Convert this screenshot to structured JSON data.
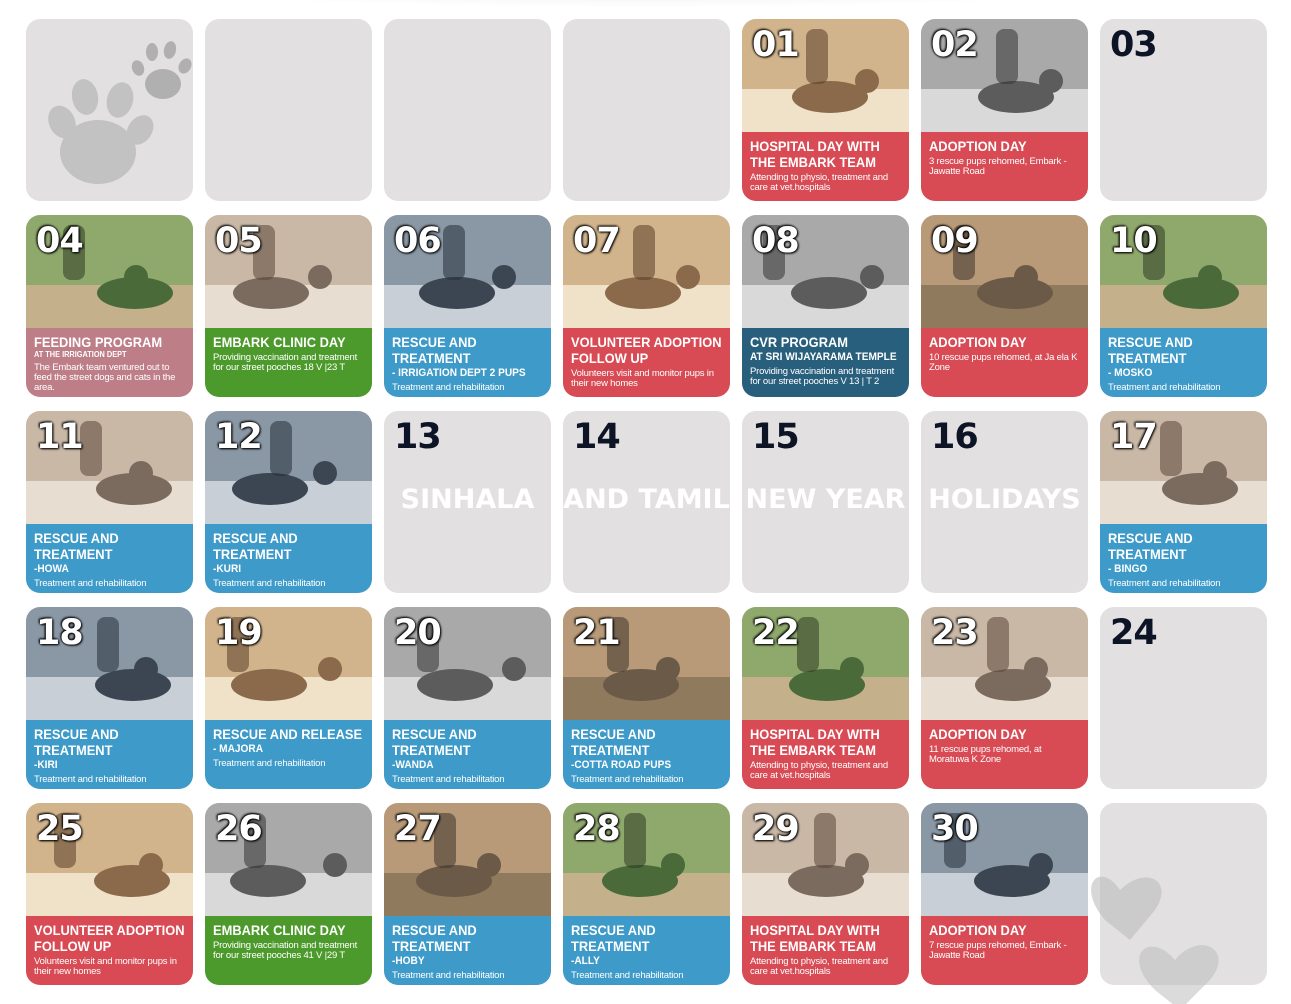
{
  "calendar": {
    "row1": [
      {
        "day": "",
        "type": "empty"
      },
      {
        "day": "",
        "type": "empty"
      },
      {
        "day": "",
        "type": "empty"
      },
      {
        "day": "",
        "type": "empty"
      },
      {
        "day": "01",
        "type": "event",
        "color": "red",
        "title": "Hospital Day with the Embark Team",
        "subtitle": "",
        "desc": "Attending to physio, treatment and care at vet.hospitals",
        "photo": "dog-photo"
      },
      {
        "day": "02",
        "type": "event",
        "color": "red",
        "title": "Adoption Day",
        "subtitle": "",
        "desc": "3 rescue pups rehomed, Embark - Jawatte Road",
        "photo": "people-dog-photo"
      },
      {
        "day": "03",
        "type": "empty"
      }
    ],
    "row2": [
      {
        "day": "04",
        "type": "event",
        "color": "pink",
        "title": "Feeding Program",
        "subtitle": "At the Irrigation Dept",
        "subtitle_size": "small",
        "desc": "The Embark team ventured out to feed the street dogs and cats in the area.",
        "photo": "dogs-photo"
      },
      {
        "day": "05",
        "type": "event",
        "color": "green",
        "title": "Embark Clinic Day",
        "subtitle": "",
        "desc": "Providing vaccination and treatment for our street pooches 18 V |23 T",
        "photo": "clinic-photo"
      },
      {
        "day": "06",
        "type": "event",
        "color": "blue",
        "title": "Rescue and Treatment",
        "subtitle": "- Irrigation Dept 2 Pups",
        "desc": "Treatment and rehabilitation",
        "photo": "pups-photo"
      },
      {
        "day": "07",
        "type": "event",
        "color": "red",
        "title": "Volunteer Adoption Follow Up",
        "subtitle": "",
        "desc": "Volunteers visit and monitor pups in their new homes",
        "photo": "woman-dog-photo"
      },
      {
        "day": "08",
        "type": "event",
        "color": "navy",
        "title": "CVR Program",
        "subtitle": "At Sri Wijayarama Temple",
        "desc": "Providing vaccination and treatment for our street pooches V 13 | T 2",
        "photo": "vaccination-photo"
      },
      {
        "day": "09",
        "type": "event",
        "color": "red",
        "title": "Adoption Day",
        "subtitle": "",
        "desc": "10 rescue pups rehomed, at Ja ela K Zone",
        "photo": "family-dog-photo"
      },
      {
        "day": "10",
        "type": "event",
        "color": "blue",
        "title": "Rescue and Treatment",
        "subtitle": "- Mosko",
        "desc": "Treatment and rehabilitation",
        "photo": "dog-lying-photo"
      }
    ],
    "row3": [
      {
        "day": "11",
        "type": "event",
        "color": "blue",
        "title": "Rescue and Treatment",
        "subtitle": "-Howa",
        "desc": "Treatment and rehabilitation",
        "photo": "dog-photo"
      },
      {
        "day": "12",
        "type": "event",
        "color": "blue",
        "title": "Rescue and Treatment",
        "subtitle": "-Kuri",
        "desc": "Treatment and rehabilitation",
        "photo": "street-photo"
      },
      {
        "day": "13",
        "type": "holiday",
        "word": "SINHALA"
      },
      {
        "day": "14",
        "type": "holiday",
        "word": "AND TAMIL"
      },
      {
        "day": "15",
        "type": "holiday",
        "word": "NEW YEAR"
      },
      {
        "day": "16",
        "type": "holiday",
        "word": "HOLIDAYS"
      },
      {
        "day": "17",
        "type": "event",
        "color": "blue",
        "title": "Rescue and Treatment",
        "subtitle": "- Bingo",
        "desc": "Treatment and rehabilitation",
        "photo": "dog-vet-photo"
      }
    ],
    "row4": [
      {
        "day": "18",
        "type": "event",
        "color": "blue",
        "title": "Rescue and Treatment",
        "subtitle": "-Kiri",
        "desc": "Treatment and rehabilitation",
        "photo": "vet-dog-photo"
      },
      {
        "day": "19",
        "type": "event",
        "color": "blue",
        "title": "Rescue and Release",
        "subtitle": "- Majora",
        "desc": "Treatment and rehabilitation",
        "photo": "dog-table-photo"
      },
      {
        "day": "20",
        "type": "event",
        "color": "blue",
        "title": "Rescue and Treatment",
        "subtitle": "-Wanda",
        "desc": "Treatment and rehabilitation",
        "photo": "dog-cage-photo"
      },
      {
        "day": "21",
        "type": "event",
        "color": "blue",
        "title": "Rescue and Treatment",
        "subtitle": "-Cotta Road Pups",
        "desc": "Treatment and rehabilitation",
        "photo": "pups-photo"
      },
      {
        "day": "22",
        "type": "event",
        "color": "red",
        "title": "Hospital Day with the Embark Team",
        "subtitle": "",
        "desc": "Attending to physio, treatment and care at vet.hospitals",
        "photo": "black-dog-photo"
      },
      {
        "day": "23",
        "type": "event",
        "color": "red",
        "title": "Adoption Day",
        "subtitle": "",
        "desc": "11 rescue pups rehomed, at Moratuwa K Zone",
        "photo": "adoption-photo"
      },
      {
        "day": "24",
        "type": "empty"
      }
    ],
    "row5": [
      {
        "day": "25",
        "type": "event",
        "color": "red",
        "title": "Volunteer Adoption Follow Up",
        "subtitle": "",
        "desc": "Volunteers visit and monitor pups in their new homes",
        "photo": "woman-dog-photo"
      },
      {
        "day": "26",
        "type": "event",
        "color": "green",
        "title": "Embark Clinic Day",
        "subtitle": "",
        "desc": "Providing vaccination and treatment for our street pooches 41 V |29 T",
        "photo": "clinic-photo"
      },
      {
        "day": "27",
        "type": "event",
        "color": "blue",
        "title": "Rescue and Treatment",
        "subtitle": "-Hoby",
        "desc": "Treatment and rehabilitation",
        "photo": "dog-sitting-photo"
      },
      {
        "day": "28",
        "type": "event",
        "color": "blue",
        "title": "Rescue and Treatment",
        "subtitle": "-Ally",
        "desc": "Treatment and rehabilitation",
        "photo": "dog-lying-photo"
      },
      {
        "day": "29",
        "type": "event",
        "color": "red",
        "title": "Hospital Day with the Embark Team",
        "subtitle": "",
        "desc": "Attending to physio, treatment and care at vet.hospitals",
        "photo": "puppy-photo"
      },
      {
        "day": "30",
        "type": "event",
        "color": "red",
        "title": "Adoption Day",
        "subtitle": "",
        "desc": "7 rescue pups rehomed, Embark - Jawatte Road",
        "photo": "man-dog-photo"
      },
      {
        "day": "",
        "type": "empty"
      }
    ]
  },
  "colors": {
    "red": "#d84b55",
    "blue": "#3d9ac9",
    "green": "#4d9a2c",
    "pink": "#bd7e88",
    "navy": "#285f7d",
    "empty": "#e3e0e1"
  }
}
